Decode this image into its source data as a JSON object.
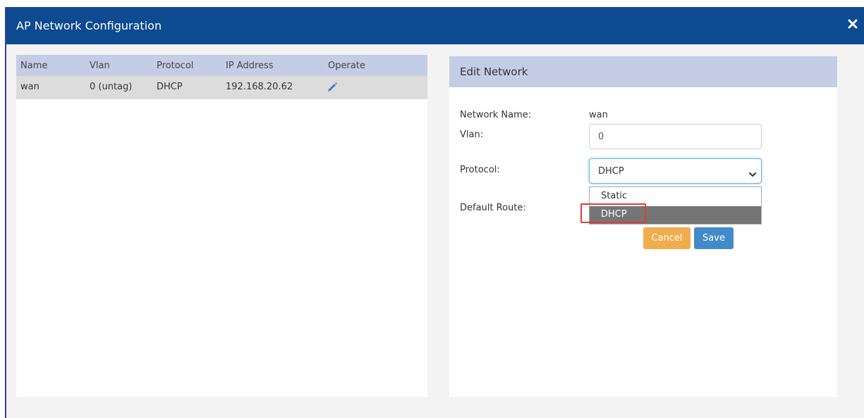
{
  "modal": {
    "title": "AP Network Configuration"
  },
  "table": {
    "headers": {
      "name": "Name",
      "vlan": "Vlan",
      "protocol": "Protocol",
      "ip": "IP Address",
      "operate": "Operate"
    },
    "rows": [
      {
        "name": "wan",
        "vlan": "0 (untag)",
        "protocol": "DHCP",
        "ip": "192.168.20.62"
      }
    ]
  },
  "edit_panel": {
    "title": "Edit Network",
    "network_name_label": "Network Name:",
    "network_name_value": "wan",
    "vlan_label": "Vlan:",
    "vlan_value": "0",
    "protocol_label": "Protocol:",
    "protocol_selected": "DHCP",
    "protocol_options": [
      "Static",
      "DHCP"
    ],
    "default_route_label": "Default Route:",
    "cancel_label": "Cancel",
    "save_label": "Save"
  },
  "icons": {
    "close": "close-icon",
    "edit": "pencil-icon",
    "dropdown": "chevron-down-icon"
  },
  "colors": {
    "header_bg": "#0d4a8f",
    "table_head_bg": "#c5cde6",
    "selected_row_bg": "#dcdcdc",
    "option_highlight_bg": "#757575",
    "highlight_border": "#e53935",
    "cancel_bg": "#f0ad4e",
    "save_bg": "#428bca"
  }
}
